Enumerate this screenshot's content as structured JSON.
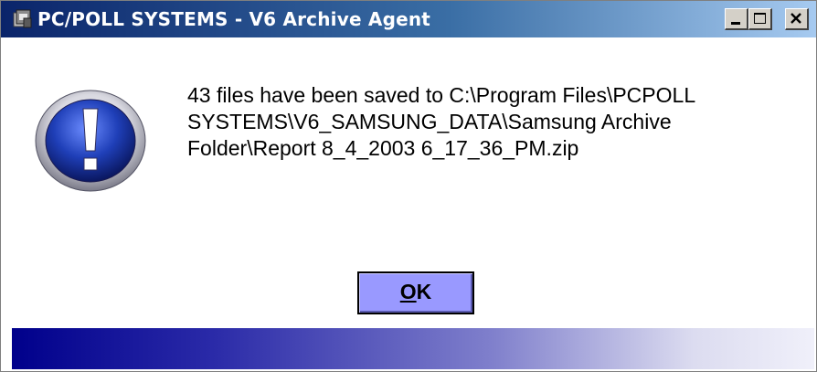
{
  "window": {
    "title": "PC/POLL SYSTEMS - V6 Archive Agent",
    "app_icon": "app-icon",
    "controls": {
      "minimize_icon": "minimize-icon",
      "maximize_icon": "maximize-icon",
      "close_icon": "close-icon"
    }
  },
  "dialog": {
    "icon": "exclamation-icon",
    "message_lines": [
      "43 files have been saved to C:\\Program Files\\PCPOLL",
      "SYSTEMS\\V6_SAMSUNG_DATA\\Samsung Archive",
      "Folder\\Report 8_4_2003 6_17_36_PM.zip"
    ],
    "ok_button": {
      "mnemonic": "O",
      "rest": "K"
    }
  },
  "colors": {
    "titlebar_start": "#0a246a",
    "button_face": "#9999ff",
    "footer_start": "#00008b"
  }
}
